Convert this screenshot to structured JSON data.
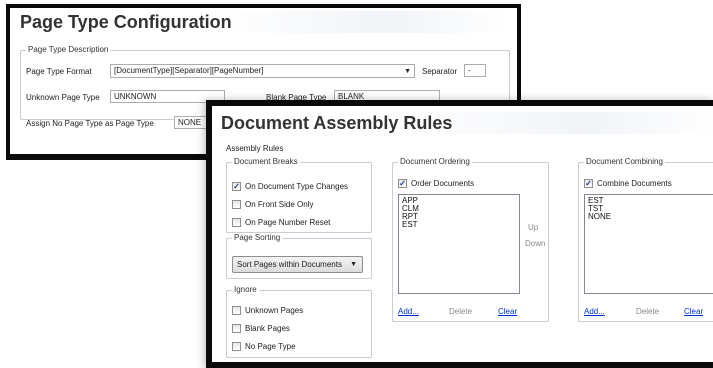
{
  "page_type_config": {
    "title": "Page Type Configuration",
    "description_group": "Page Type Description",
    "format_label": "Page Type Format",
    "format_value": "[DocumentType][Separator][PageNumber]",
    "separator_label": "Separator",
    "separator_value": "-",
    "unknown_label": "Unknown Page Type",
    "unknown_value": "UNKNOWN",
    "blank_label": "Blank Page Type",
    "blank_value": "BLANK",
    "assign_label": "Assign No Page Type as Page Type",
    "assign_value": "NONE"
  },
  "assembly": {
    "title": "Document Assembly Rules",
    "group_label": "Assembly Rules",
    "breaks": {
      "label": "Document Breaks",
      "items": [
        {
          "label": "On Document Type Changes",
          "checked": true
        },
        {
          "label": "On Front Side Only",
          "checked": false
        },
        {
          "label": "On Page Number Reset",
          "checked": false
        }
      ]
    },
    "sorting": {
      "label": "Page Sorting",
      "value": "Sort Pages within Documents"
    },
    "ignore": {
      "label": "Ignore",
      "items": [
        {
          "label": "Unknown Pages",
          "checked": false
        },
        {
          "label": "Blank Pages",
          "checked": false
        },
        {
          "label": "No Page Type",
          "checked": false
        }
      ]
    },
    "ordering": {
      "label": "Document Ordering",
      "checkbox_label": "Order Documents",
      "checked": true,
      "items": [
        "APP",
        "CLM",
        "RPT",
        "EST"
      ],
      "up_label": "Up",
      "down_label": "Down",
      "add_label": "Add...",
      "delete_label": "Delete",
      "clear_label": "Clear"
    },
    "combining": {
      "label": "Document Combining",
      "checkbox_label": "Combine Documents",
      "checked": true,
      "items": [
        "EST",
        "TST",
        "NONE"
      ],
      "add_label": "Add...",
      "delete_label": "Delete",
      "clear_label": "Clear"
    }
  },
  "colors": {
    "border": "#0a0a0a",
    "link": "#0033cc",
    "check": "#1a3c8a"
  }
}
